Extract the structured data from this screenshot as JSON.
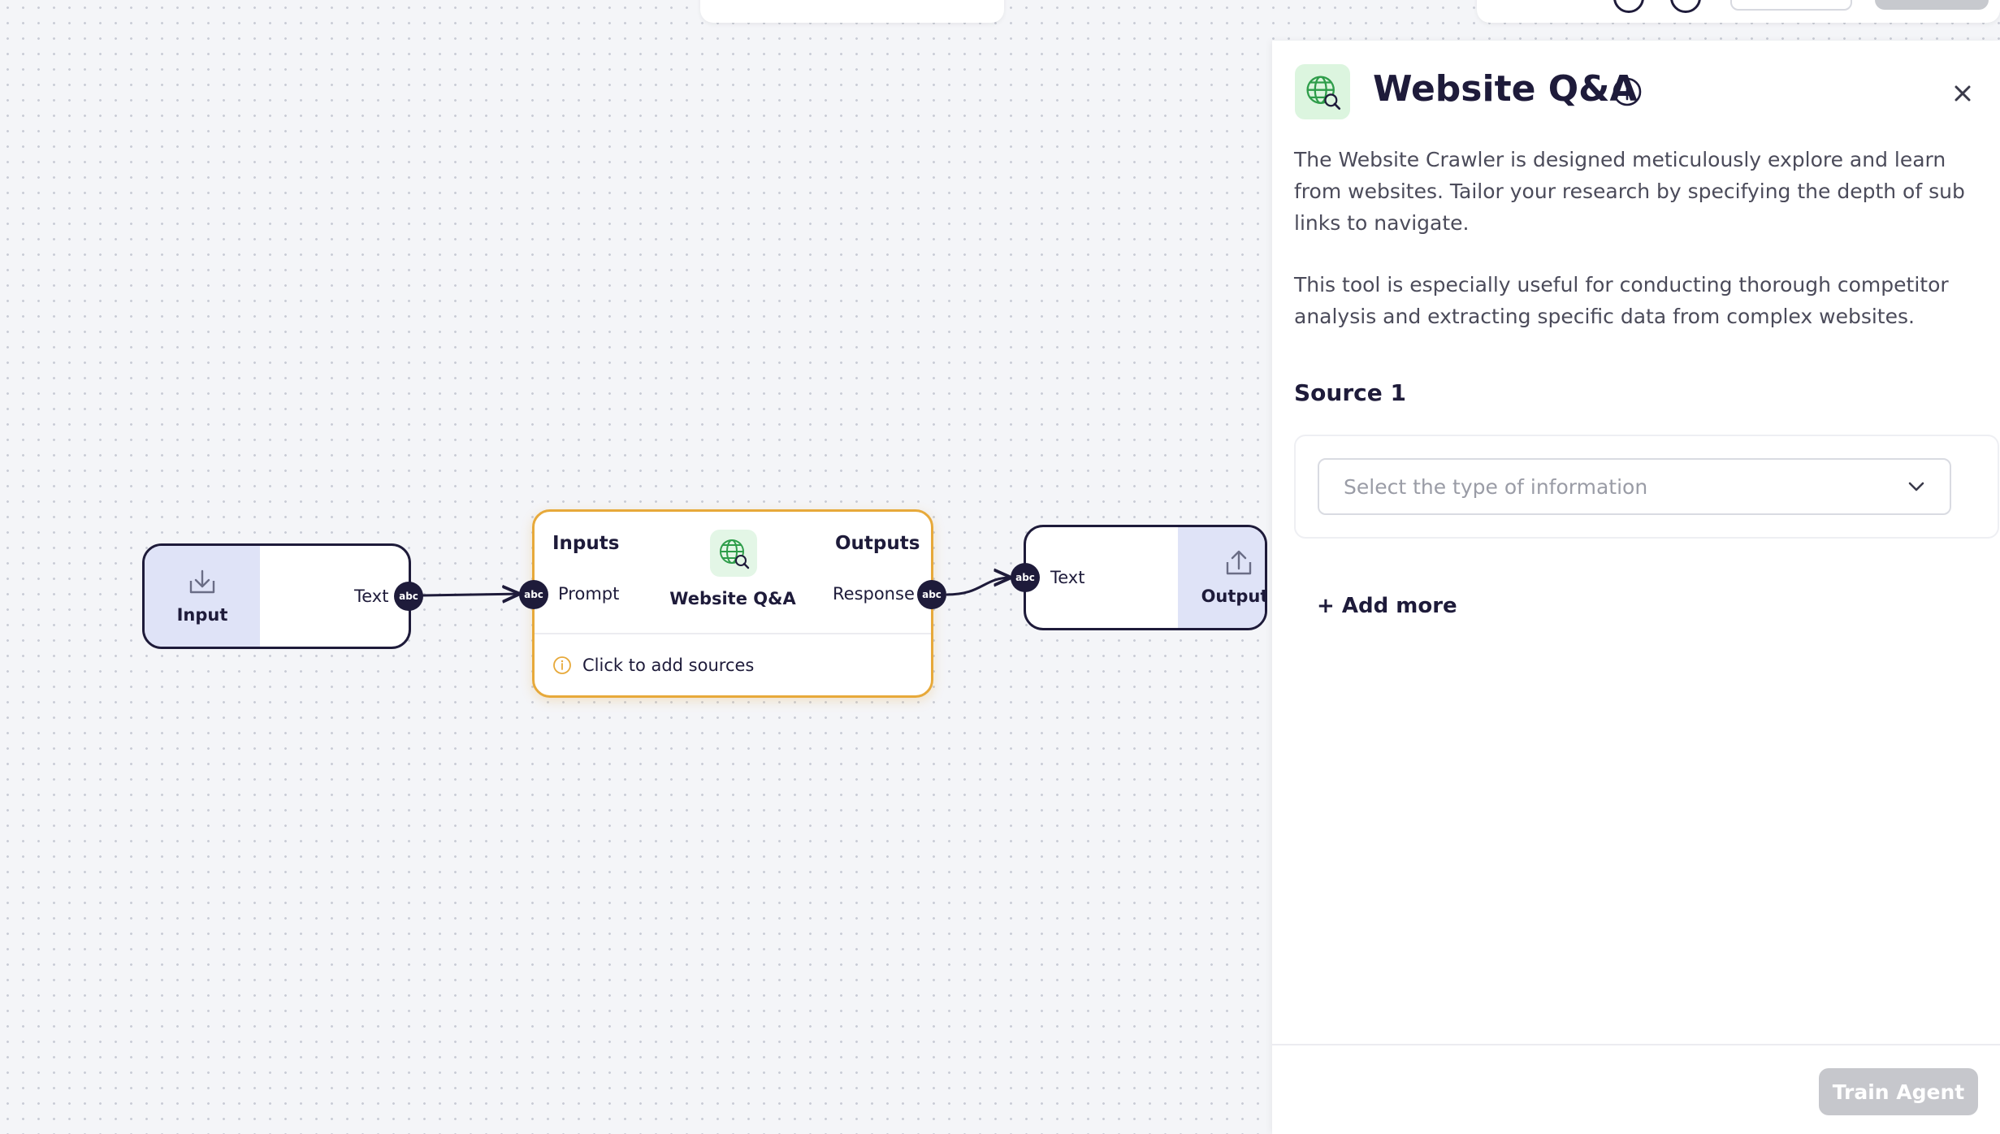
{
  "canvas": {
    "input_node": {
      "label": "Input",
      "port_label": "Text",
      "port_type": "abc"
    },
    "qa_node": {
      "inputs_heading": "Inputs",
      "outputs_heading": "Outputs",
      "title": "Website Q&A",
      "input_port_label": "Prompt",
      "input_port_type": "abc",
      "output_port_label": "Response",
      "output_port_type": "abc",
      "hint": "Click to add sources"
    },
    "output_node": {
      "label": "Output",
      "port_label": "Text",
      "port_type": "abc"
    }
  },
  "panel": {
    "title": "Website Q&A",
    "description_1": "The Website Crawler is designed meticulously explore and learn from websites. Tailor your research by specifying the depth of sub links to navigate.",
    "description_2": "This tool is especially useful for conducting thorough competitor analysis and extracting specific data from complex websites.",
    "source_title": "Source 1",
    "select_placeholder": "Select the type of information",
    "add_more": "+ Add more",
    "train_button": "Train Agent"
  },
  "colors": {
    "node_dark": "#1e1b3a",
    "qa_border": "#e7a93a",
    "globe_green": "#2e9d4a",
    "disabled_button": "#c6c7cc"
  },
  "icons": [
    "download-icon",
    "upload-icon",
    "globe-search-icon",
    "info-icon",
    "close-icon",
    "chevron-down-icon"
  ]
}
